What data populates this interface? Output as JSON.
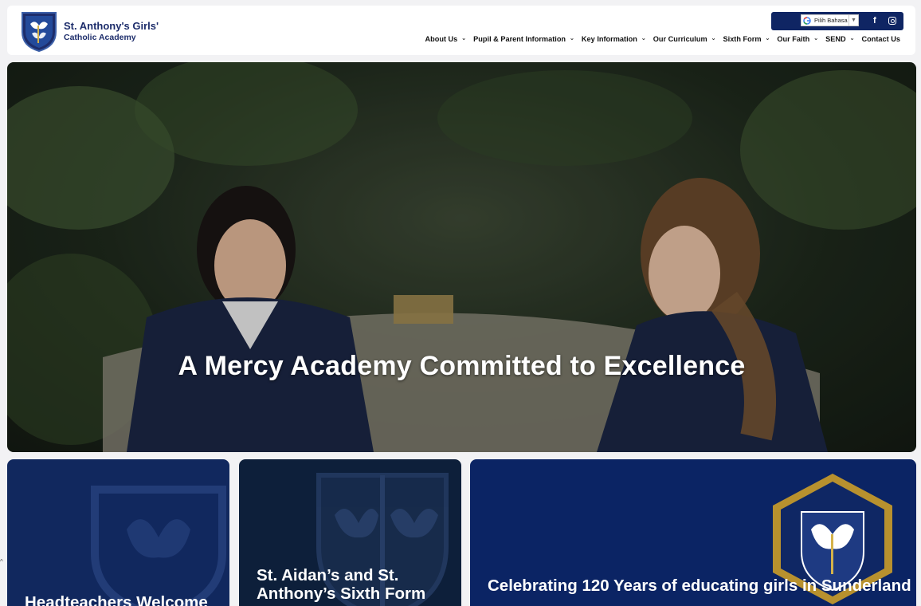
{
  "brand": {
    "name_line1": "St. Anthony's Girls'",
    "name_line2": "Catholic Academy",
    "navy": "#1d2d6b"
  },
  "topbar": {
    "translate_label": "Pilih Bahasa",
    "translate_arrow": "▼",
    "facebook_icon": "f",
    "bg": "#0f2563"
  },
  "nav": {
    "items": [
      {
        "label": "About Us",
        "dropdown": true
      },
      {
        "label": "Pupil & Parent Information",
        "dropdown": true
      },
      {
        "label": "Key Information",
        "dropdown": true
      },
      {
        "label": "Our Curriculum",
        "dropdown": true
      },
      {
        "label": "Sixth Form",
        "dropdown": true
      },
      {
        "label": "Our Faith",
        "dropdown": true
      },
      {
        "label": "SEND",
        "dropdown": true
      },
      {
        "label": "Contact Us",
        "dropdown": false
      }
    ],
    "chevron": "⌄"
  },
  "hero": {
    "title": "A Mercy Academy Committed to Excellence"
  },
  "cards": [
    {
      "title": "Headteachers Welcome"
    },
    {
      "title": "St. Aidan’s and St. Anthony’s Sixth Form"
    },
    {
      "title": "Celebrating 120 Years of educating girls in Sunderland"
    }
  ],
  "edge_mark": "^"
}
